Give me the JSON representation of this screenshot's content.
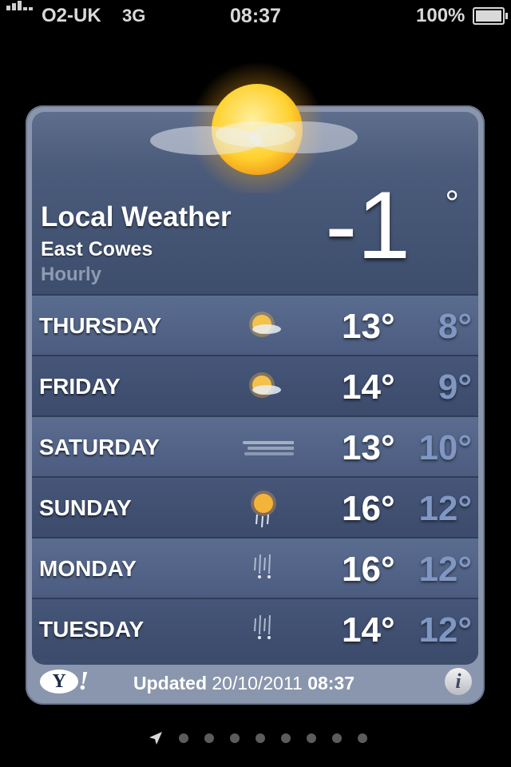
{
  "status_bar": {
    "carrier": "O2-UK",
    "network": "3G",
    "time": "08:37",
    "battery_percent": "100%",
    "signal_bars": 5
  },
  "weather": {
    "title": "Local Weather",
    "location": "East Cowes",
    "mode": "Hourly",
    "current_temp": "-1",
    "degree_symbol": "°",
    "current_icon": "sun-cloud-icon",
    "forecast": [
      {
        "day": "THURSDAY",
        "icon": "sun-cloud-icon",
        "high": "13°",
        "low": "8°"
      },
      {
        "day": "FRIDAY",
        "icon": "sun-cloud-icon",
        "high": "14°",
        "low": "9°"
      },
      {
        "day": "SATURDAY",
        "icon": "fog-icon",
        "high": "13°",
        "low": "10°"
      },
      {
        "day": "SUNDAY",
        "icon": "sun-rain-icon",
        "high": "16°",
        "low": "12°"
      },
      {
        "day": "MONDAY",
        "icon": "rain-icon",
        "high": "16°",
        "low": "12°"
      },
      {
        "day": "TUESDAY",
        "icon": "rain-icon",
        "high": "14°",
        "low": "12°"
      }
    ]
  },
  "footer": {
    "provider_logo": "Y!",
    "updated_label": "Updated",
    "updated_date": "20/10/2011",
    "updated_time": "08:37",
    "info_label": "i"
  },
  "pager": {
    "pages": 8,
    "current": 0,
    "location_icon": "location-arrow-icon"
  },
  "colors": {
    "card_bg": "#4b5b7b",
    "low_temp": "#7f97c2",
    "background": "#000000"
  }
}
